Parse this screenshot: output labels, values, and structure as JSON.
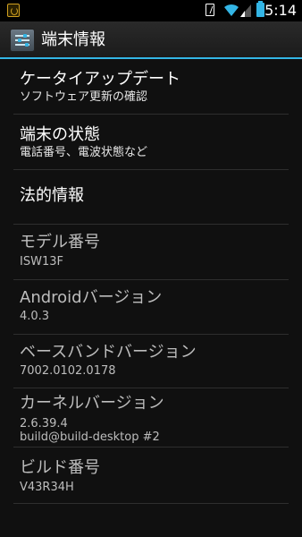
{
  "status_bar": {
    "time": "5:14",
    "icons": [
      "notification-app-icon",
      "sim-icon",
      "wifi-icon",
      "signal-icon",
      "battery-icon"
    ],
    "accent_color": "#33b5e5"
  },
  "action_bar": {
    "title": "端末情報",
    "icon": "settings-icon"
  },
  "items": [
    {
      "title": "ケータイアップデート",
      "summary": "ソフトウェア更新の確認"
    },
    {
      "title": "端末の状態",
      "summary": "電話番号、電波状態など"
    },
    {
      "title": "法的情報"
    },
    {
      "title": "モデル番号",
      "summary": "ISW13F"
    },
    {
      "title": "Androidバージョン",
      "summary": "4.0.3"
    },
    {
      "title": "ベースバンドバージョン",
      "summary": "7002.0102.0178"
    },
    {
      "title": "カーネルバージョン",
      "summary": "2.6.39.4",
      "summary2": "build@build-desktop #2"
    },
    {
      "title": "ビルド番号",
      "summary": "V43R34H"
    }
  ]
}
